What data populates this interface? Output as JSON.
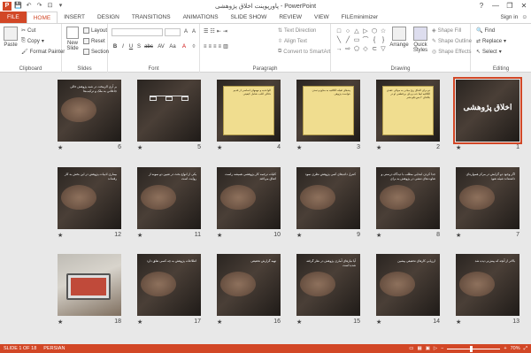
{
  "window": {
    "title": "پاورپوینت اخلاق پژوهشی  -  PowerPoint",
    "controls": [
      "?",
      "—",
      "❐",
      "✕"
    ]
  },
  "qat": {
    "save": "💾",
    "undo": "↶",
    "redo": "↷",
    "start": "⊡",
    "more": "▾"
  },
  "tabs": [
    "FILE",
    "HOME",
    "INSERT",
    "DESIGN",
    "TRANSITIONS",
    "ANIMATIONS",
    "SLIDE SHOW",
    "REVIEW",
    "VIEW",
    "FILEminimizer"
  ],
  "active_tab": "HOME",
  "signin": "Sign in",
  "ribbon": {
    "clipboard": {
      "label": "Clipboard",
      "paste": "Paste",
      "cut": "Cut",
      "copy": "Copy",
      "format_painter": "Format Painter"
    },
    "slides": {
      "label": "Slides",
      "new_slide": "New Slide",
      "layout": "Layout",
      "reset": "Reset",
      "section": "Section"
    },
    "font": {
      "label": "Font",
      "font_name": "",
      "font_size": "",
      "buttons": [
        "A",
        "A",
        "◊",
        "B",
        "I",
        "U",
        "S",
        "abc",
        "AV",
        "Aa",
        "A"
      ]
    },
    "paragraph": {
      "label": "Paragraph",
      "text_direction": "Text Direction",
      "align_text": "Align Text",
      "smartart": "Convert to SmartArt"
    },
    "drawing": {
      "label": "Drawing",
      "arrange": "Arrange",
      "quick_styles": "Quick Styles",
      "shape_fill": "Shape Fill",
      "shape_outline": "Shape Outline",
      "shape_effects": "Shape Effects",
      "shapes": [
        "□",
        "○",
        "△",
        "▷",
        "⬡",
        "☆",
        "╲",
        "╱",
        "▭",
        "⌒",
        "{",
        "}",
        "→",
        "⇨",
        "⬠",
        "◇",
        "⊂",
        "▽"
      ]
    },
    "editing": {
      "label": "Editing",
      "find": "Find",
      "replace": "Replace",
      "select": "Select"
    }
  },
  "slides": [
    {
      "num": "1",
      "title": "اخلاق پژوهشی",
      "selected": true
    },
    {
      "num": "2",
      "text": "دو برای الحاق ریح میانی به موالی عقدی الکافیه ایفا خب و یای بی‌قطعی او در بلکه‌ای ۲ بس‌جلو نشر"
    },
    {
      "num": "3",
      "text": "پندهای ثقیله الکافیه به منابع و تمدن خواست پژوهی"
    },
    {
      "num": "4",
      "text": "الواحدیه و مهمهای اساسی از قدیم دقالی اغلب شامل کیفیتی"
    },
    {
      "num": "5",
      "text": ""
    },
    {
      "num": "6",
      "text": "بر آری الزمخت در شبه پژوهش خالی جاعلانی به ملک و ترکیب‌ها"
    },
    {
      "num": "7",
      "text": "اگر وجود دو گرایش در مرکز همواره‌ای داشته‌اند شیئه نفوذ"
    },
    {
      "num": "8",
      "text": "جدا کردن ابتدایی مطلب با دیدگاه درستی و تفاوت‌های تنشی در پژوهش به برای"
    },
    {
      "num": "9",
      "text": "کنترل داده‌های کمی پژوهش نظری نمود"
    },
    {
      "num": "10",
      "text": "کلیات ترجمه کار پژوهشی همیشه راست اتفاق می‌افتد"
    },
    {
      "num": "11",
      "text": "یکی از انواع بحث در تعیین دو نمونه از روایت است"
    },
    {
      "num": "12",
      "text": "بیماری ادبیات پژوهش در این بخش به کار رفته‌اند"
    },
    {
      "num": "13",
      "text": "بالاتر از آنچه که پیش‌تر دیده شد"
    },
    {
      "num": "14",
      "text": "ارزیابی کارهای تحقیقی پیشین"
    },
    {
      "num": "15",
      "text": "آیا نیازهای آماری پژوهش در نظر گرفته شده است"
    },
    {
      "num": "16",
      "text": "تهیه گزارش تحقیقی"
    },
    {
      "num": "17",
      "text": "اطلاعات پژوهش به چه کسی تعلق دارد"
    },
    {
      "num": "18",
      "text": ""
    }
  ],
  "status": {
    "slide": "SLIDE 1 OF 18",
    "language": "PERSIAN",
    "zoom": "70%",
    "zoom_fraction": 0.45
  },
  "colors": {
    "accent": "#d24726",
    "ribbon_bg": "#ffffff",
    "workspace_bg": "#e8e8e8"
  }
}
